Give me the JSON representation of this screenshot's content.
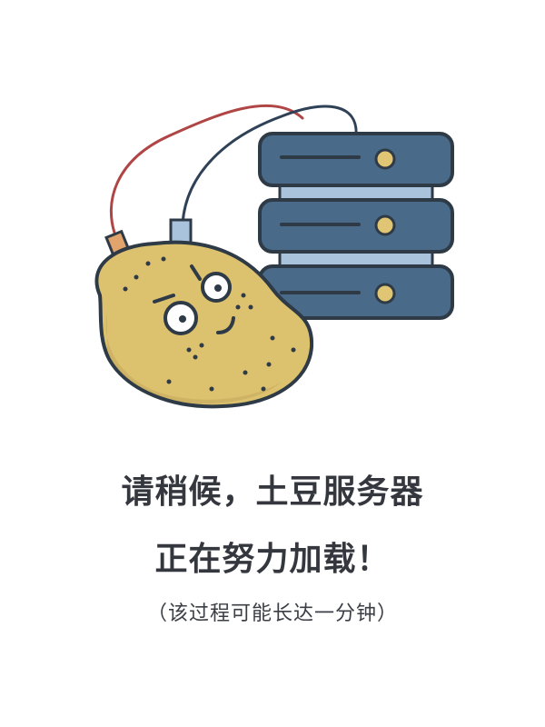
{
  "loading_screen": {
    "headline_line1": "请稍候，土豆服务器",
    "headline_line2": "正在努力加载！",
    "note": "（该过程可能长达一分钟）"
  },
  "illustration": {
    "subject": "potato-connected-to-server",
    "icons": [
      "potato-icon",
      "server-stack-icon",
      "red-cable-icon",
      "blue-cable-icon"
    ]
  },
  "colors": {
    "text": "#34373d",
    "outline": "#2e3a46",
    "server_body": "#4a6a8a",
    "server_gap": "#a9c3dd",
    "server_light": "#e0c674",
    "potato": "#dcc16e",
    "red_cable": "#b04545",
    "blue_cable": "#2f4156"
  }
}
